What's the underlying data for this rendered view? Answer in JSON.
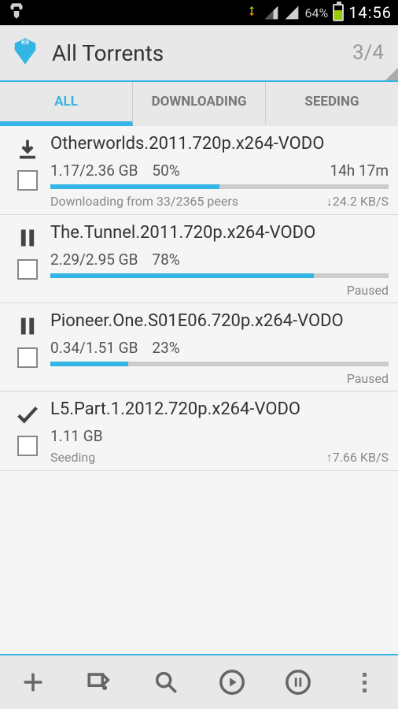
{
  "status_bar": {
    "battery_pct": "64%",
    "time": "14:56"
  },
  "header": {
    "title": "All Torrents",
    "counter": "3/4"
  },
  "tabs": [
    {
      "label": "ALL",
      "active": true
    },
    {
      "label": "DOWNLOADING",
      "active": false
    },
    {
      "label": "SEEDING",
      "active": false
    }
  ],
  "torrents": [
    {
      "state": "downloading",
      "name": "Otherworlds.2011.720p.x264-VODO",
      "size": "1.17/2.36 GB",
      "pct_label": "50%",
      "progress": 50,
      "eta": "14h 17m",
      "status_left": "Downloading from 33/2365 peers",
      "status_right": "↓24.2 KB/S"
    },
    {
      "state": "paused",
      "name": "The.Tunnel.2011.720p.x264-VODO",
      "size": "2.29/2.95 GB",
      "pct_label": "78%",
      "progress": 78,
      "eta": "",
      "status_left": "",
      "status_right": "Paused"
    },
    {
      "state": "paused",
      "name": "Pioneer.One.S01E06.720p.x264-VODO",
      "size": "0.34/1.51 GB",
      "pct_label": "23%",
      "progress": 23,
      "eta": "",
      "status_left": "",
      "status_right": "Paused"
    },
    {
      "state": "done",
      "name": "L5.Part.1.2012.720p.x264-VODO",
      "size": "1.11 GB",
      "pct_label": "",
      "progress": null,
      "eta": "",
      "status_left": "Seeding",
      "status_right": "↑7.66 KB/S"
    }
  ]
}
